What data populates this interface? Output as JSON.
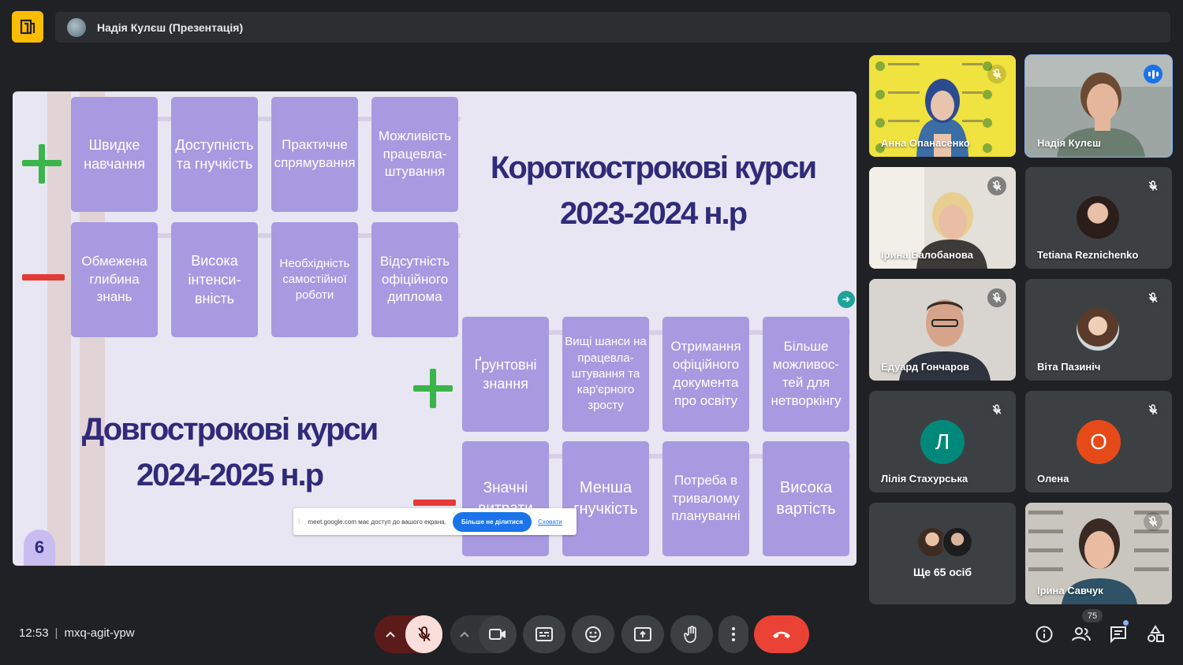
{
  "presenter": {
    "name": "Надія Кулєш (Презентація)"
  },
  "slide": {
    "page_number": "6",
    "title_short": [
      "Короткострокові курси",
      "2023-2024 н.р"
    ],
    "title_long": [
      "Довгострокові курси",
      "2024-2025 н.р"
    ],
    "short_pros": [
      "Швидке навчання",
      "Доступність та гнучкість",
      "Практичне спрямування",
      "Можливість працевла-штування"
    ],
    "short_cons": [
      "Обмежена глибина знань",
      "Висока інтенси-вність",
      "Необхідність самостійної роботи",
      "Відсутність офіційного диплома"
    ],
    "long_pros": [
      "Ґрунтовні знання",
      "Вищі шанси на працевла-штування та кар'єрного зросту",
      "Отримання офіційного документа про освіту",
      "Більше можливос-тей для нетворкінгу"
    ],
    "long_cons": [
      "Значні витрати",
      "Менша гнучкість",
      "Потреба в тривалому плануванні",
      "Висока вартість"
    ]
  },
  "share_notice": {
    "message": "meet.google.com має доступ до вашого екрана.",
    "stop_label": "Більше не ділитися",
    "hide_label": "Сховати"
  },
  "participants": [
    {
      "name": "Анна Опанасенко",
      "muted": true
    },
    {
      "name": "Надія Кулєш",
      "muted": false,
      "speaking": true
    },
    {
      "name": "Ірина Балобанова",
      "muted": true
    },
    {
      "name": "Tetiana Reznichenko",
      "muted": true
    },
    {
      "name": "Едуард Гончаров",
      "muted": true
    },
    {
      "name": "Віта Пазиніч",
      "muted": true
    },
    {
      "name": "Лілія Стахурська",
      "muted": true,
      "initial": "Л",
      "color": "#00897b"
    },
    {
      "name": "Олена",
      "muted": true,
      "initial": "О",
      "color": "#e64a19"
    },
    {
      "name": "Ще 65 осіб"
    },
    {
      "name": "Ірина Савчук",
      "muted": true
    }
  ],
  "meeting": {
    "time": "12:53",
    "code": "mxq-agit-ypw",
    "participant_count": "75"
  },
  "colors": {
    "accent": "#8ab4f8",
    "end_call": "#ea4335",
    "tile_bg": "#3c4043",
    "mic_off_bg": "#f9dedc"
  }
}
